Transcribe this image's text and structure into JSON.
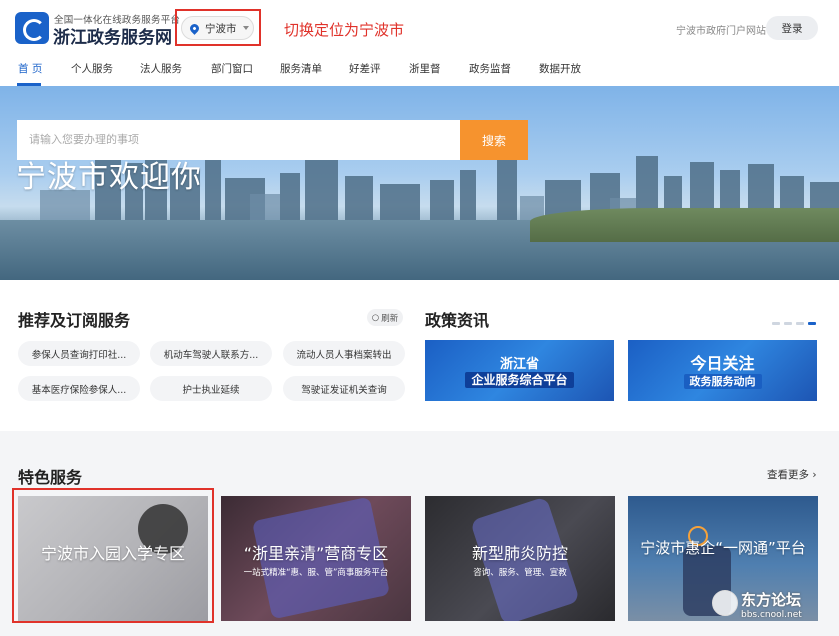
{
  "header": {
    "brand_sub": "全国一体化在线政务服务平台",
    "brand_title": "浙江政务服务网",
    "location": "宁波市",
    "annotation": "切换定位为宁波市",
    "portal_link": "宁波市政府门户网站",
    "login_label": "登录"
  },
  "nav": {
    "items": [
      "首 页",
      "个人服务",
      "法人服务",
      "部门窗口",
      "服务清单",
      "好差评",
      "浙里督",
      "政务监督",
      "数据开放"
    ],
    "active_index": 0
  },
  "banner": {
    "title": "宁波市欢迎你",
    "search_placeholder": "请输入您要办理的事项",
    "search_button": "搜索"
  },
  "recommend": {
    "title": "推荐及订阅服务",
    "refresh_label": "刷新",
    "items": [
      "参保人员查询打印社...",
      "机动车驾驶人联系方...",
      "流动人员人事档案转出",
      "基本医疗保险参保人...",
      "护士执业延续",
      "驾驶证发证机关查询"
    ]
  },
  "news": {
    "title": "政策资讯",
    "cards": [
      {
        "line1": "浙江省",
        "line2": "企业服务综合平台"
      },
      {
        "line1": "今日关注",
        "line2": "政务服务动向"
      }
    ],
    "carousel_count": 4,
    "carousel_active": 3
  },
  "featured": {
    "title": "特色服务",
    "more_label": "查看更多",
    "cards": [
      {
        "title": "宁波市入园入学专区",
        "sub": ""
      },
      {
        "title": "“浙里亲清”营商专区",
        "sub": "一站式精准“惠、服、管”商事服务平台"
      },
      {
        "title": "新型肺炎防控",
        "sub": "咨询、服务、管理、宣教"
      },
      {
        "title": "宁波市惠企“一网通”平台",
        "sub": ""
      }
    ]
  },
  "watermark": {
    "line1": "东方论坛",
    "line2": "bbs.cnool.net"
  },
  "colors": {
    "brand_blue": "#1a62c9",
    "search_orange": "#f6932e",
    "annotation_red": "#e0322a"
  }
}
